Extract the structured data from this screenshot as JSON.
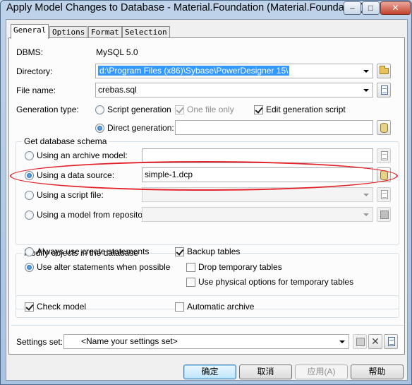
{
  "window": {
    "title": "Apply Model Changes to Database - Material.Foundation (Material.Foundation)",
    "controls": {
      "minimize": "–",
      "maximize": "□",
      "close": "✕"
    }
  },
  "tabs": [
    {
      "label": "General",
      "active": true
    },
    {
      "label": "Options",
      "active": false
    },
    {
      "label": "Format",
      "active": false
    },
    {
      "label": "Selection",
      "active": false
    }
  ],
  "general": {
    "dbms_label": "DBMS:",
    "dbms_value": "MySQL 5.0",
    "directory_label": "Directory:",
    "directory_value": "d:\\Program Files (x86)\\Sybase\\PowerDesigner 15\\",
    "filename_label": "File name:",
    "filename_value": "crebas.sql",
    "gentype_label": "Generation type:",
    "script_generation": "Script generation",
    "one_file_only": "One file only",
    "edit_generation_script": "Edit generation script",
    "direct_generation": "Direct generation:",
    "direct_generation_value": ""
  },
  "schema": {
    "legend": "Get database schema",
    "archive_label": "Using an archive model:",
    "archive_value": "",
    "datasource_label": "Using a data source:",
    "datasource_value": "simple-1.dcp",
    "scriptfile_label": "Using a script file:",
    "scriptfile_value": "",
    "repository_label": "Using a model from repository:",
    "repository_value": ""
  },
  "modify": {
    "legend": "Modify objects in the database",
    "always_create": "Always use create statements",
    "use_alter": "Use alter statements when possible",
    "backup_tables": "Backup tables",
    "drop_temp": "Drop temporary tables",
    "use_physical": "Use physical options for temporary tables"
  },
  "checks": {
    "check_model": "Check model",
    "automatic_archive": "Automatic archive"
  },
  "settings": {
    "label": "Settings set:",
    "value": "<Name your settings set>"
  },
  "buttons": {
    "ok": "确定",
    "cancel": "取消",
    "apply": "应用(A)",
    "help": "帮助"
  },
  "colors": {
    "highlight_ellipse": "#e3242b",
    "selection": "#3399ff",
    "title_bar": "#bfd3ea"
  }
}
